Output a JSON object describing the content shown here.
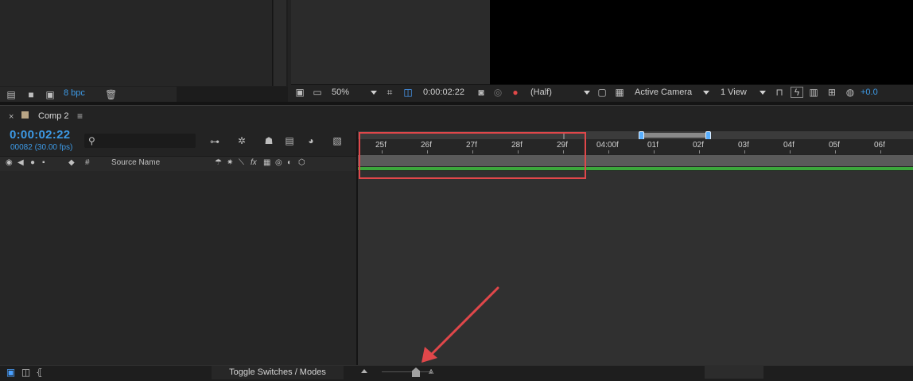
{
  "project": {
    "bpc_label": "8 bpc"
  },
  "viewer": {
    "zoom": "50%",
    "timecode": "0:00:02:22",
    "resolution": "(Half)",
    "camera": "Active Camera",
    "views": "1 View",
    "exposure": "+0.0"
  },
  "timeline": {
    "comp_name": "Comp 2",
    "timecode": "0:00:02:22",
    "frame_info": "00082 (30.00 fps)",
    "search_icon": "search-icon",
    "col_source_name": "Source Name",
    "col_hash": "#",
    "ruler_labels": [
      "25f",
      "26f",
      "27f",
      "28f",
      "29f",
      "04:00f",
      "01f",
      "02f",
      "03f",
      "04f",
      "05f",
      "06f"
    ],
    "toggle_label": "Toggle Switches / Modes"
  },
  "colors": {
    "accent": "#3d9ae6",
    "highlight": "#e0474a",
    "layer_bar": "#3ca73c"
  }
}
